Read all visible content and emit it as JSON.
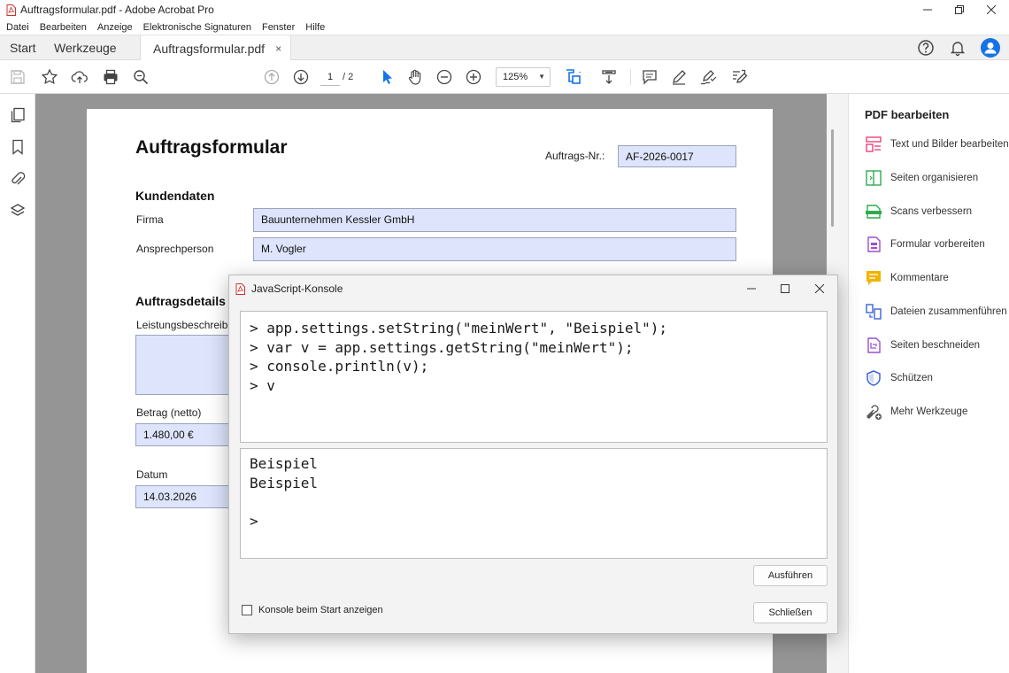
{
  "window": {
    "title": "Auftragsformular.pdf - Adobe Acrobat Pro"
  },
  "menu": [
    "Datei",
    "Bearbeiten",
    "Anzeige",
    "Elektronische Signaturen",
    "Fenster",
    "Hilfe"
  ],
  "tabs": {
    "start": "Start",
    "tools": "Werkzeuge",
    "document": "Auftragsformular.pdf",
    "close": "×"
  },
  "toolbar": {
    "page_current": "1",
    "page_total": "/ 2",
    "zoom": "125%"
  },
  "form": {
    "title": "Auftragsformular",
    "order_no_label": "Auftrags-Nr.:",
    "order_no": "AF-2026-0017",
    "section_customer": "Kundendaten",
    "company_label": "Firma",
    "company": "Bauunternehmen Kessler GmbH",
    "contact_label": "Ansprechperson",
    "contact": "M. Vogler",
    "section_order": "Auftragsdetails",
    "description_label": "Leistungsbeschreibung",
    "amount_label": "Betrag (netto)",
    "amount": "1.480,00 €",
    "date_label": "Datum",
    "date": "14.03.2026"
  },
  "right_panel": {
    "title": "PDF bearbeiten",
    "items": [
      "Text und Bilder bearbeiten",
      "Seiten organisieren",
      "Scans verbessern",
      "Formular vorbereiten",
      "Kommentare",
      "Dateien zusammenführen",
      "Seiten beschneiden",
      "Schützen",
      "Mehr Werkzeuge"
    ]
  },
  "console": {
    "title": "JavaScript-Konsole",
    "input_lines": [
      "> app.settings.setString(\"meinWert\", \"Beispiel\");",
      "> var v = app.settings.getString(\"meinWert\");",
      "> console.println(v);",
      "> v"
    ],
    "output_lines": [
      "Beispiel",
      "Beispiel",
      "",
      ">"
    ],
    "run_button": "Ausführen",
    "close_button": "Schließen",
    "show_on_start": "Konsole beim Start anzeigen"
  },
  "colors": {
    "pdf_red": "#d0312d",
    "accent_blue": "#1473e6",
    "form_field": "#dde4fb"
  }
}
